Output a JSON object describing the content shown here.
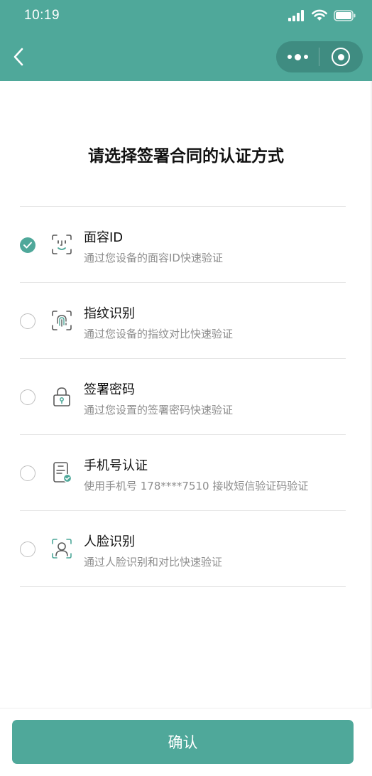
{
  "status_bar": {
    "time": "10:19",
    "signal_icon": "signal-icon",
    "wifi_icon": "wifi-icon",
    "battery_icon": "battery-icon"
  },
  "nav_bar": {
    "back_icon": "back-icon",
    "more_icon": "more-dots-icon",
    "close_icon": "target-close-icon"
  },
  "page": {
    "title": "请选择签署合同的认证方式"
  },
  "options": [
    {
      "title": "面容ID",
      "desc": "通过您设备的面容ID快速验证",
      "icon": "face-id-icon",
      "selected": true
    },
    {
      "title": "指纹识别",
      "desc": "通过您设备的指纹对比快速验证",
      "icon": "fingerprint-icon",
      "selected": false
    },
    {
      "title": "签署密码",
      "desc": "通过您设置的签署密码快速验证",
      "icon": "lock-icon",
      "selected": false
    },
    {
      "title": "手机号认证",
      "desc": "使用手机号 178****7510 接收短信验证码验证",
      "icon": "phone-verified-icon",
      "selected": false
    },
    {
      "title": "人脸识别",
      "desc": "通过人脸识别和对比快速验证",
      "icon": "face-recognition-icon",
      "selected": false
    }
  ],
  "footer": {
    "confirm_label": "确认"
  },
  "colors": {
    "accent": "#4fa89a",
    "capsule": "#3f8c81",
    "icon_stroke": "#5a5a5a",
    "desc_text": "#8e8e8e"
  }
}
